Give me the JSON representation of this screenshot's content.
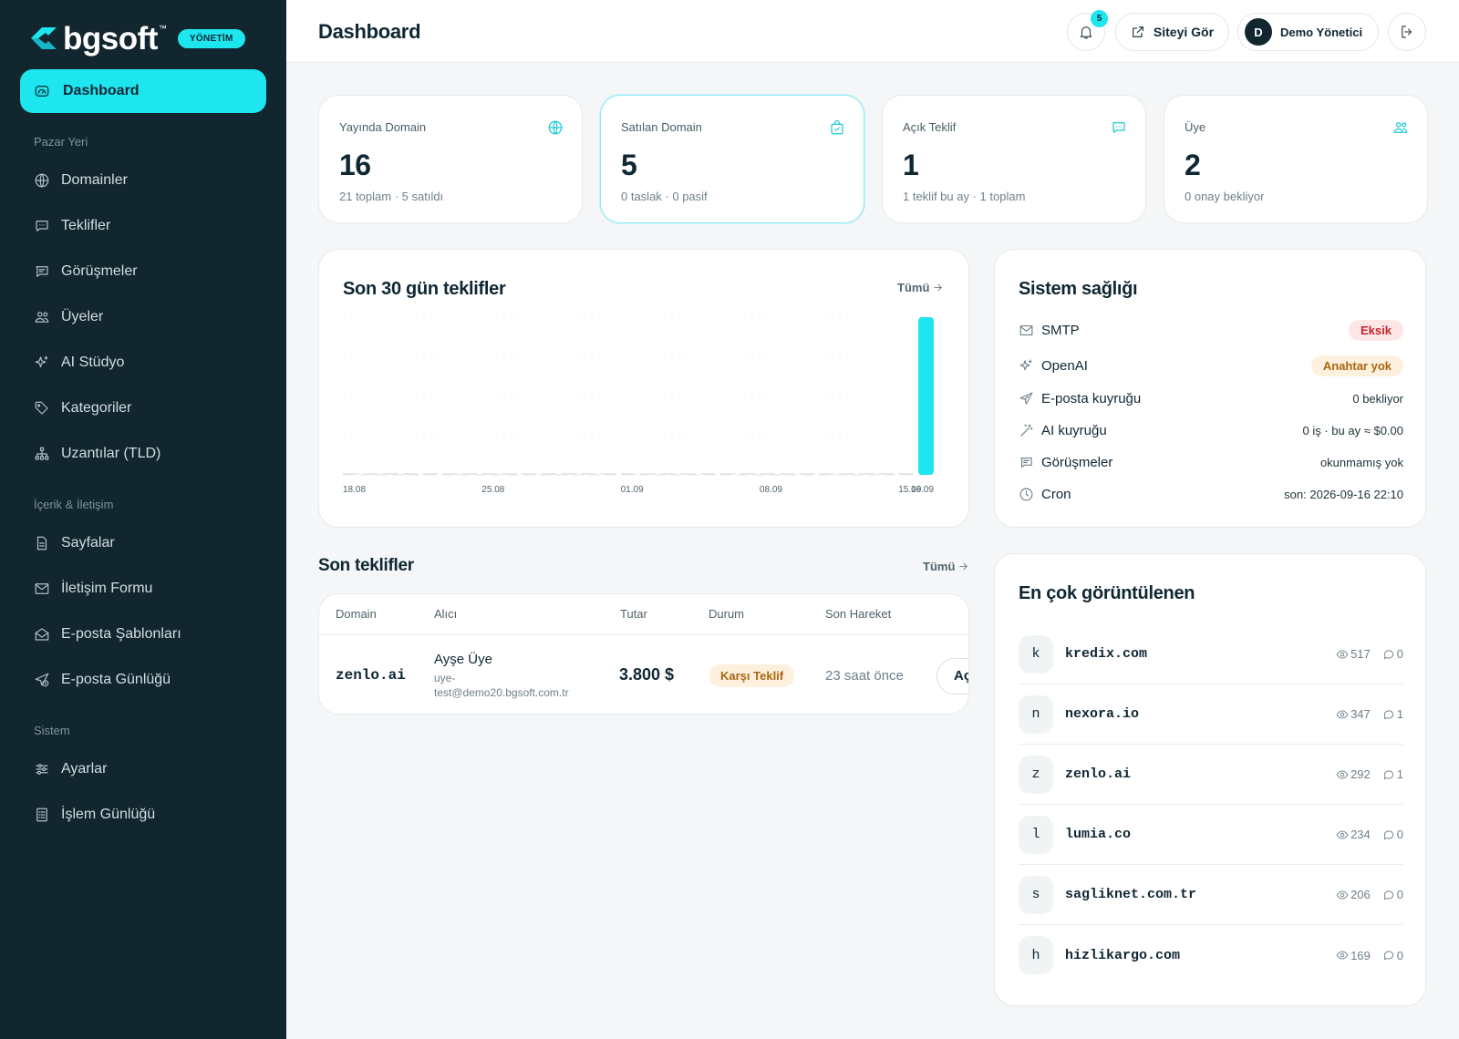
{
  "brand": {
    "name": "bgsoft",
    "tm": "™",
    "badge": "YÖNETİM"
  },
  "sidebar": {
    "active": {
      "label": "Dashboard",
      "icon": "gauge-icon"
    },
    "sections": [
      {
        "title": "Pazar Yeri",
        "items": [
          {
            "label": "Domainler",
            "icon": "globe-icon"
          },
          {
            "label": "Teklifler",
            "icon": "message-dots-icon"
          },
          {
            "label": "Görüşmeler",
            "icon": "chat-lines-icon"
          },
          {
            "label": "Üyeler",
            "icon": "users-icon"
          },
          {
            "label": "AI Stüdyo",
            "icon": "sparkles-icon"
          },
          {
            "label": "Kategoriler",
            "icon": "tag-icon"
          },
          {
            "label": "Uzantılar (TLD)",
            "icon": "sitemap-icon"
          }
        ]
      },
      {
        "title": "İçerik & İletişim",
        "items": [
          {
            "label": "Sayfalar",
            "icon": "file-icon"
          },
          {
            "label": "İletişim Formu",
            "icon": "mail-icon"
          },
          {
            "label": "E-posta Şablonları",
            "icon": "mail-open-icon"
          },
          {
            "label": "E-posta Günlüğü",
            "icon": "send-clock-icon"
          }
        ]
      },
      {
        "title": "Sistem",
        "items": [
          {
            "label": "Ayarlar",
            "icon": "sliders-icon"
          },
          {
            "label": "İşlem Günlüğü",
            "icon": "list-doc-icon"
          }
        ]
      }
    ]
  },
  "header": {
    "title": "Dashboard",
    "notification_count": "5",
    "site_button": "Siteyi Gör",
    "user": {
      "initial": "D",
      "name": "Demo Yönetici"
    }
  },
  "stats": [
    {
      "label": "Yayında Domain",
      "value": "16",
      "sub": "21 toplam · 5 satıldı",
      "icon": "globe-icon"
    },
    {
      "label": "Satılan Domain",
      "value": "5",
      "sub": "0 taslak · 0 pasif",
      "icon": "bag-check-icon"
    },
    {
      "label": "Açık Teklif",
      "value": "1",
      "sub": "1 teklif bu ay · 1 toplam",
      "icon": "message-dots-icon"
    },
    {
      "label": "Üye",
      "value": "2",
      "sub": "0 onay bekliyor",
      "icon": "users-icon"
    }
  ],
  "offers_chart": {
    "title": "Son 30 gün teklifler",
    "link": "Tümü"
  },
  "chart_data": {
    "type": "bar",
    "title": "Son 30 gün teklifler",
    "x_tick_labels": [
      "18.08",
      "25.08",
      "01.09",
      "08.09",
      "15.09",
      "16.09"
    ],
    "categories": [
      "18.08",
      "19.08",
      "20.08",
      "21.08",
      "22.08",
      "23.08",
      "24.08",
      "25.08",
      "26.08",
      "27.08",
      "28.08",
      "29.08",
      "30.08",
      "31.08",
      "01.09",
      "02.09",
      "03.09",
      "04.09",
      "05.09",
      "06.09",
      "07.09",
      "08.09",
      "09.09",
      "10.09",
      "11.09",
      "12.09",
      "13.09",
      "14.09",
      "15.09",
      "16.09"
    ],
    "values": [
      0,
      0,
      0,
      0,
      0,
      0,
      0,
      0,
      0,
      0,
      0,
      0,
      0,
      0,
      0,
      0,
      0,
      0,
      0,
      0,
      0,
      0,
      0,
      0,
      0,
      0,
      0,
      0,
      0,
      1
    ],
    "ylim": [
      0,
      1
    ],
    "grid": true,
    "color": "#1ee6ef"
  },
  "health": {
    "title": "Sistem sağlığı",
    "rows": [
      {
        "label": "SMTP",
        "value": "Eksik",
        "kind": "red",
        "icon": "mail-icon"
      },
      {
        "label": "OpenAI",
        "value": "Anahtar yok",
        "kind": "amber",
        "icon": "sparkles-icon"
      },
      {
        "label": "E-posta kuyruğu",
        "value": "0 bekliyor",
        "kind": "text",
        "icon": "send-icon"
      },
      {
        "label": "AI kuyruğu",
        "value": "0 iş · bu ay ≈ $0.00",
        "kind": "text",
        "icon": "wand-icon"
      },
      {
        "label": "Görüşmeler",
        "value": "okunmamış yok",
        "kind": "text",
        "icon": "chat-lines-icon"
      },
      {
        "label": "Cron",
        "value": "son: 2026-09-16 22:10",
        "kind": "text",
        "icon": "clock-icon"
      }
    ]
  },
  "recent_offers": {
    "title": "Son teklifler",
    "link": "Tümü",
    "columns": [
      "Domain",
      "Alıcı",
      "Tutar",
      "Durum",
      "Son Hareket"
    ],
    "rows": [
      {
        "domain": "zenlo.ai",
        "buyer_name": "Ayşe Üye",
        "buyer_email_1": "uye-",
        "buyer_email_2": "test@demo20.bgsoft.com.tr",
        "amount": "3.800 $",
        "status": "Karşı Teklif",
        "last": "23 saat önce",
        "action": "Aç"
      }
    ]
  },
  "top_viewed": {
    "title": "En çok görüntülenen",
    "rows": [
      {
        "letter": "k",
        "domain": "kredix.com",
        "views": "517",
        "comments": "0"
      },
      {
        "letter": "n",
        "domain": "nexora.io",
        "views": "347",
        "comments": "1"
      },
      {
        "letter": "z",
        "domain": "zenlo.ai",
        "views": "292",
        "comments": "1"
      },
      {
        "letter": "l",
        "domain": "lumia.co",
        "views": "234",
        "comments": "0"
      },
      {
        "letter": "s",
        "domain": "sagliknet.com.tr",
        "views": "206",
        "comments": "0"
      },
      {
        "letter": "h",
        "domain": "hizlikargo.com",
        "views": "169",
        "comments": "0"
      }
    ]
  }
}
